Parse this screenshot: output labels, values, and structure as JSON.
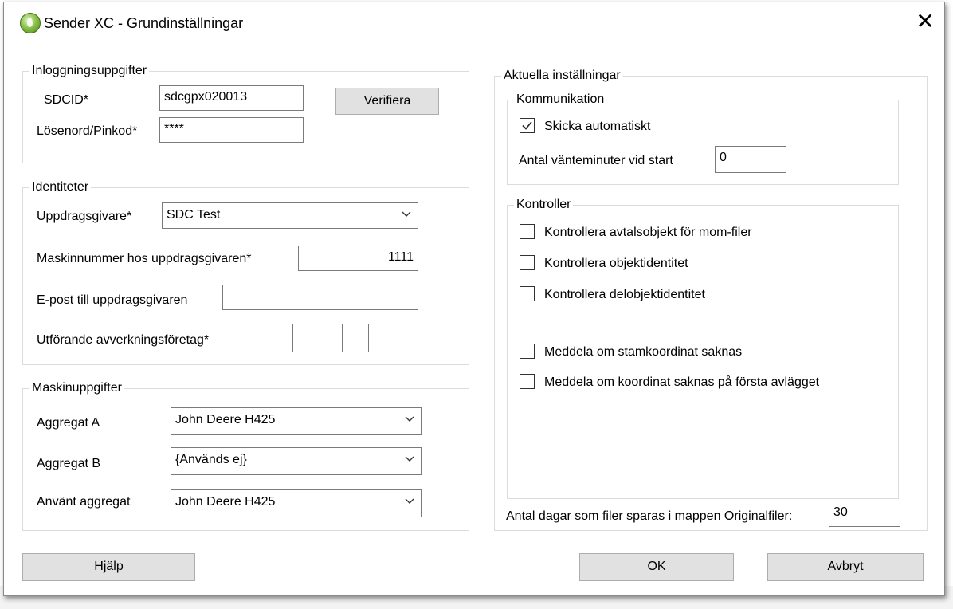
{
  "window": {
    "title": "Sender XC - Grundinställningar"
  },
  "login": {
    "legend": "Inloggningsuppgifter",
    "sdcid_label": "SDCID*",
    "sdcid_value": "sdcgpx020013",
    "password_label": "Lösenord/Pinkod*",
    "password_value": "****",
    "verify_button": "Verifiera"
  },
  "identities": {
    "legend": "Identiteter",
    "client_label": "Uppdragsgivare*",
    "client_value": "SDC Test",
    "machine_no_label": "Maskinnummer hos uppdragsgivaren*",
    "machine_no_value": "1111",
    "email_label": "E-post till uppdragsgivaren",
    "email_value": "",
    "contractor_label": "Utförande avverkningsföretag*",
    "contractor_value_1": "",
    "contractor_value_2": ""
  },
  "machine": {
    "legend": "Maskinuppgifter",
    "aggA_label": "Aggregat A",
    "aggA_value": "John Deere H425",
    "aggB_label": "Aggregat B",
    "aggB_value": "{Används ej}",
    "used_label": "Använt aggregat",
    "used_value": "John Deere H425"
  },
  "settings": {
    "legend": "Aktuella inställningar",
    "communication": {
      "legend": "Kommunikation",
      "auto_send_label": "Skicka automatiskt",
      "auto_send_checked": true,
      "wait_label": "Antal vänteminuter vid start",
      "wait_value": "0"
    },
    "controls": {
      "legend": "Kontroller",
      "items": [
        {
          "label": "Kontrollera avtalsobjekt för mom-filer",
          "checked": false
        },
        {
          "label": "Kontrollera objektidentitet",
          "checked": false
        },
        {
          "label": "Kontrollera delobjektidentitet",
          "checked": false
        },
        {
          "label": "Meddela om stamkoordinat saknas",
          "checked": false
        },
        {
          "label": "Meddela om koordinat saknas på första avlägget",
          "checked": false
        }
      ]
    },
    "days_label": "Antal dagar som filer sparas i mappen Originalfiler:",
    "days_value": "30"
  },
  "buttons": {
    "help": "Hjälp",
    "ok": "OK",
    "cancel": "Avbryt"
  }
}
